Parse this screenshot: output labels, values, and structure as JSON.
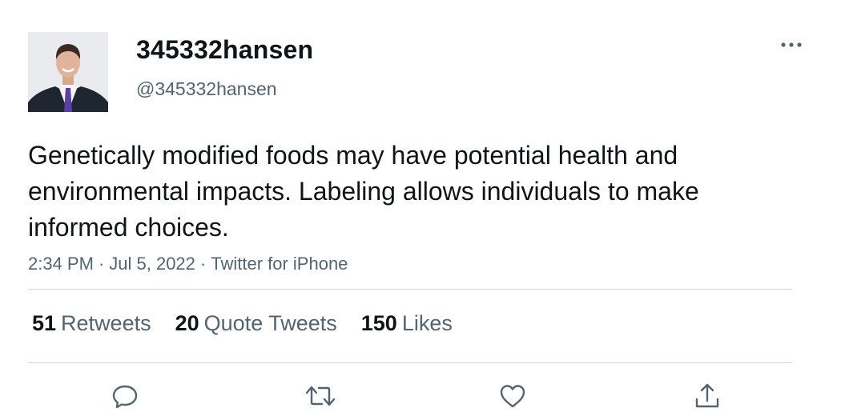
{
  "user": {
    "display_name": "345332hansen",
    "handle": "@345332hansen"
  },
  "tweet": {
    "text": "Genetically modified foods may have potential health and environmental impacts. Labeling allows individuals to make informed choices.",
    "time": "2:34 PM",
    "date": "Jul 5, 2022",
    "source": "Twitter for iPhone",
    "separator": "·"
  },
  "stats": {
    "retweets_count": "51",
    "retweets_label": "Retweets",
    "quotes_count": "20",
    "quotes_label": "Quote Tweets",
    "likes_count": "150",
    "likes_label": "Likes"
  },
  "icons": {
    "more": "more-icon",
    "reply": "reply-icon",
    "retweet": "retweet-icon",
    "like": "heart-icon",
    "share": "share-icon"
  },
  "colors": {
    "text_primary": "#0f1419",
    "text_secondary": "#536471",
    "divider": "#cfd9de"
  }
}
